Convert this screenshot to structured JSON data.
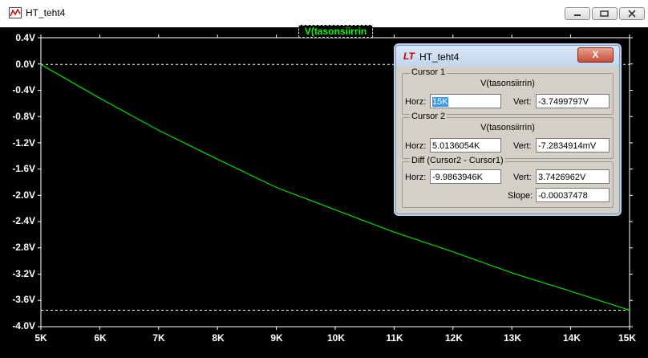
{
  "window": {
    "title": "HT_teht4"
  },
  "plot": {
    "trace_label": "V(tasonsiirrin"
  },
  "dialog": {
    "title": "HT_teht4",
    "close_symbol": "X",
    "cursor1": {
      "group_label": "Cursor 1",
      "trace": "V(tasonsiirrin)",
      "horz_label": "Horz:",
      "horz_value": "15K",
      "vert_label": "Vert:",
      "vert_value": "-3.7499797V"
    },
    "cursor2": {
      "group_label": "Cursor 2",
      "trace": "V(tasonsiirrin)",
      "horz_label": "Horz:",
      "horz_value": "5.0136054K",
      "vert_label": "Vert:",
      "vert_value": "-7.2834914mV"
    },
    "diff": {
      "group_label": "Diff (Cursor2 - Cursor1)",
      "horz_label": "Horz:",
      "horz_value": "-9.9863946K",
      "vert_label": "Vert:",
      "vert_value": "3.7426962V",
      "slope_label": "Slope:",
      "slope_value": "-0.00037478"
    }
  },
  "chart_data": {
    "type": "line",
    "series": [
      {
        "name": "V(tasonsiirrin)",
        "color": "#00dd00",
        "x": [
          5000,
          6000,
          7000,
          8000,
          9000,
          10000,
          11000,
          12000,
          13000,
          14000,
          15000
        ],
        "y": [
          -0.007,
          -0.52,
          -1.01,
          -1.45,
          -1.88,
          -2.22,
          -2.56,
          -2.86,
          -3.18,
          -3.46,
          -3.75
        ]
      }
    ],
    "x_ticks": [
      "5K",
      "6K",
      "7K",
      "8K",
      "9K",
      "10K",
      "11K",
      "12K",
      "13K",
      "14K",
      "15K"
    ],
    "y_ticks": [
      "0.4V",
      "0.0V",
      "-0.4V",
      "-0.8V",
      "-1.2V",
      "-1.6V",
      "-2.0V",
      "-2.4V",
      "-2.8V",
      "-3.2V",
      "-3.6V",
      "-4.0V"
    ],
    "xlim": [
      5000,
      15000
    ],
    "ylim": [
      -4.0,
      0.4
    ],
    "cursor_levels": [
      -0.007,
      -3.75
    ],
    "grid": false,
    "colors": {
      "trace": "#00dd00",
      "background": "#000000",
      "axes": "#ffffff"
    }
  }
}
